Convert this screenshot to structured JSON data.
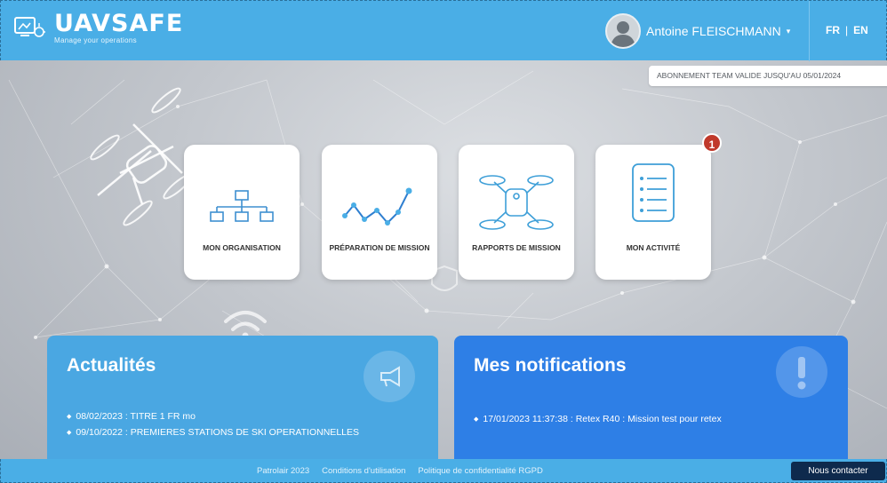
{
  "colors": {
    "header": "#4aaee6",
    "news_panel": "#4aa7e2",
    "notif_panel": "#2e7fe6",
    "contact_button": "#0e2a4d",
    "alert_badge": "#c0392b"
  },
  "header": {
    "logo_name": "UAVSAFE",
    "logo_tagline": "Manage your operations",
    "logo_icon": "drone-screen-icon",
    "user_name": "Antoine FLEISCHMANN",
    "user_caret": "▾",
    "languages": [
      "FR",
      "EN"
    ],
    "language_separator": "|"
  },
  "subscription": {
    "text": "ABONNEMENT TEAM VALIDE JUSQU'AU 05/01/2024"
  },
  "tiles": [
    {
      "label": "MON ORGANISATION",
      "icon": "org-chart-icon"
    },
    {
      "label": "PRÉPARATION DE MISSION",
      "icon": "flight-path-icon"
    },
    {
      "label": "RAPPORTS DE MISSION",
      "icon": "drone-icon"
    },
    {
      "label": "MON ACTIVITÉ",
      "icon": "checklist-icon",
      "badge": "1"
    }
  ],
  "news": {
    "title": "Actualités",
    "icon": "megaphone-icon",
    "items": [
      "08/02/2023 : TITRE 1 FR mo",
      "09/10/2022 : PREMIERES STATIONS DE SKI OPERATIONNELLES"
    ]
  },
  "notifications": {
    "title": "Mes notifications",
    "icon": "exclamation-icon",
    "items": [
      "17/01/2023 11:37:38 : Retex R40 : Mission test pour retex"
    ]
  },
  "footer": {
    "links": [
      "Patrolair 2023",
      "Conditions d'utilisation",
      "Politique de confidentialité RGPD"
    ],
    "contact_label": "Nous contacter"
  }
}
